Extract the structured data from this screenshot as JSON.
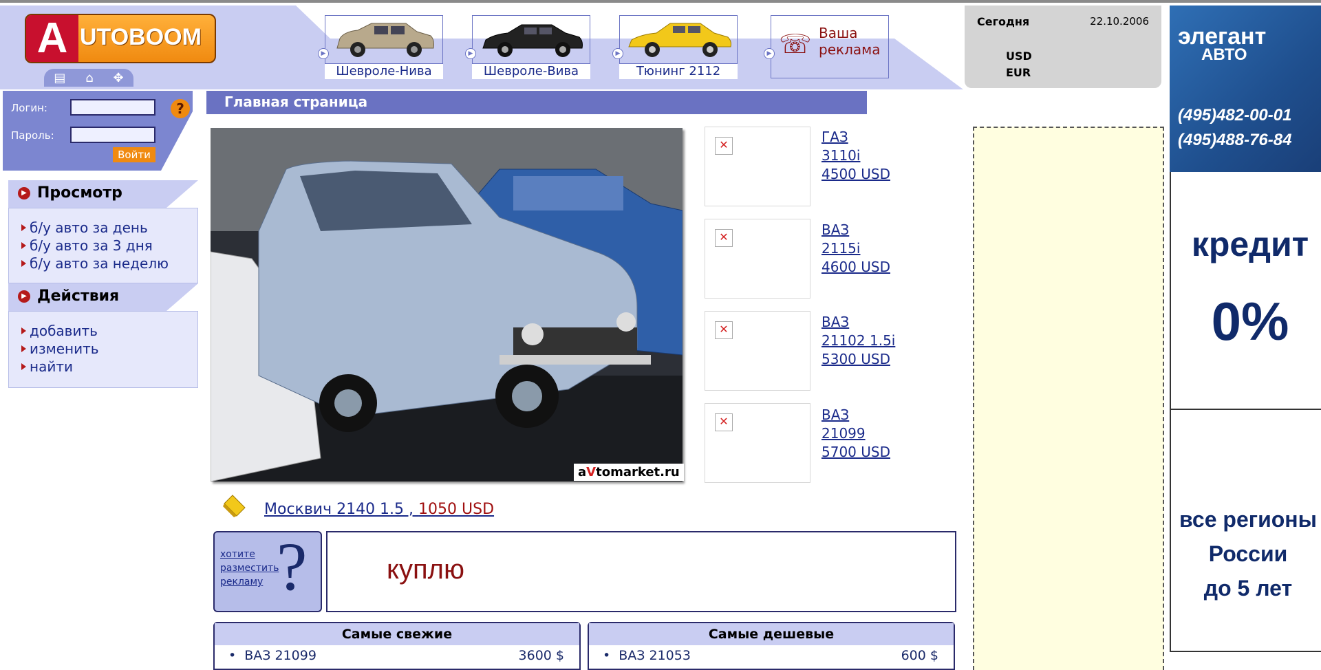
{
  "header": {
    "logo_letter": "A",
    "logo_text": "UTOBOOM",
    "logo_icons": [
      "page-icon",
      "home-icon",
      "move-icon"
    ],
    "car_tiles": [
      {
        "label": "Шевроле-Нива",
        "color": "#b8a98c"
      },
      {
        "label": "Шевроле-Вива",
        "color": "#222222"
      },
      {
        "label": "Тюнинг 2112",
        "color": "#f2c81a"
      }
    ],
    "ad_tile": {
      "line1": "Ваша",
      "line2": "реклама"
    }
  },
  "rates": {
    "today_label": "Сегодня",
    "date": "22.10.2006",
    "usd": "USD",
    "eur": "EUR"
  },
  "login": {
    "login_label": "Логин:",
    "password_label": "Пароль:",
    "help": "?",
    "submit": "Войти"
  },
  "sidebar": {
    "view": {
      "title": "Просмотр",
      "items": [
        "б/у авто за день",
        "б/у авто за 3 дня",
        "б/у авто за неделю"
      ]
    },
    "actions": {
      "title": "Действия",
      "items": [
        "добавить",
        "изменить",
        "найти"
      ]
    }
  },
  "main": {
    "page_title": "Главная страница",
    "watermark_a": "a",
    "watermark_v": "V",
    "watermark_rest": "tomarket.ru",
    "thumbs": [
      {
        "make": "ГАЗ",
        "model": "3110i",
        "price": "4500  USD"
      },
      {
        "make": "ВАЗ",
        "model": "2115i",
        "price": "4600  USD"
      },
      {
        "make": "ВАЗ",
        "model": "21102 1.5i",
        "price": "5300  USD"
      },
      {
        "make": "ВАЗ",
        "model": "21099",
        "price": "5700  USD"
      }
    ],
    "featured": {
      "name": "Москвич 2140 1.5 , ",
      "price": "1050  USD"
    },
    "advert": {
      "line1": "хотите",
      "line2": "разместить",
      "line3": "рекламу",
      "mark": "?"
    },
    "buy": "куплю",
    "fresh": {
      "title": "Самые свежие",
      "item": "ВАЗ 21099",
      "price": "3600  $"
    },
    "cheap": {
      "title": "Самые дешевые",
      "item": "ВАЗ 21053",
      "price": "600  $"
    }
  },
  "right_ads": {
    "elegant": {
      "logo1": "элегант",
      "logo2": "АВТО",
      "phone1": "(495)482-00-01",
      "phone2": "(495)488-76-84"
    },
    "credit": {
      "word": "кредит",
      "pct": "0%"
    },
    "regions": {
      "line1": "все регионы",
      "line2": "России",
      "line3": "до 5 лет"
    }
  }
}
